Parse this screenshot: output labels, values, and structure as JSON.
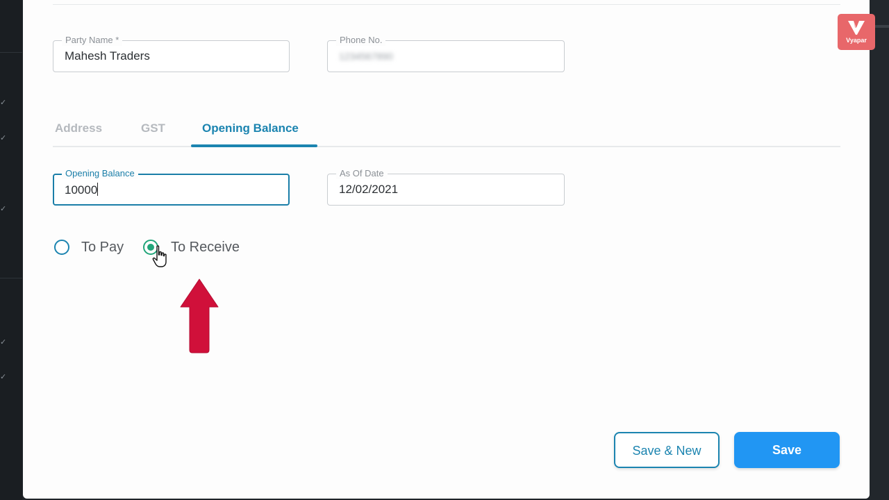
{
  "party_name": {
    "label": "Party Name *",
    "value": "Mahesh Traders"
  },
  "phone": {
    "label": "Phone No.",
    "value": "1234567890"
  },
  "tabs": [
    {
      "label": "Address"
    },
    {
      "label": "GST"
    },
    {
      "label": "Opening Balance"
    }
  ],
  "opening_balance": {
    "label": "Opening Balance",
    "value": "10000"
  },
  "as_of_date": {
    "label": "As Of Date",
    "value": "12/02/2021"
  },
  "balance_type": {
    "options": [
      {
        "label": "To Pay",
        "selected": false
      },
      {
        "label": "To Receive",
        "selected": true
      }
    ]
  },
  "buttons": {
    "save_new": "Save & New",
    "save": "Save"
  },
  "brand": {
    "name": "Vyapar",
    "color": "#e8676a"
  },
  "colors": {
    "accent": "#1b84b0",
    "primary_button": "#2196f3",
    "radio_checked": "#22a57a",
    "arrow": "#d0103a"
  },
  "icons": {
    "cursor": "hand-pointer-icon",
    "arrow": "up-arrow-icon"
  }
}
